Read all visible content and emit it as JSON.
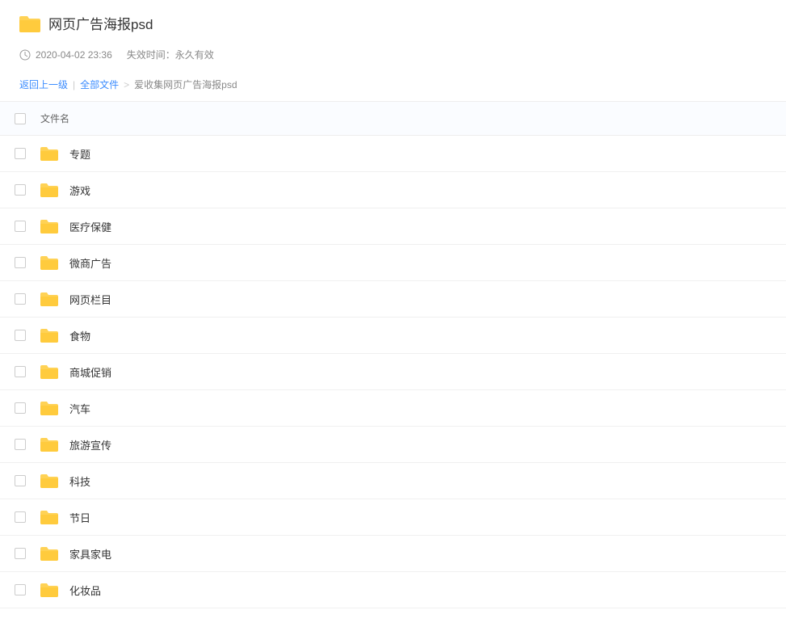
{
  "header": {
    "title": "网页广告海报psd",
    "timestamp": "2020-04-02 23:36",
    "expiry_label": "失效时间：",
    "expiry_value": "永久有效"
  },
  "breadcrumb": {
    "back": "返回上一级",
    "all_files": "全部文件",
    "current": "爱收集网页广告海报psd"
  },
  "table": {
    "col_name": "文件名"
  },
  "items": [
    {
      "name": "专题"
    },
    {
      "name": "游戏"
    },
    {
      "name": "医疗保健"
    },
    {
      "name": "微商广告"
    },
    {
      "name": "网页栏目"
    },
    {
      "name": "食物"
    },
    {
      "name": "商城促销"
    },
    {
      "name": "汽车"
    },
    {
      "name": "旅游宣传"
    },
    {
      "name": "科技"
    },
    {
      "name": "节日"
    },
    {
      "name": "家具家电"
    },
    {
      "name": "化妆品"
    }
  ]
}
